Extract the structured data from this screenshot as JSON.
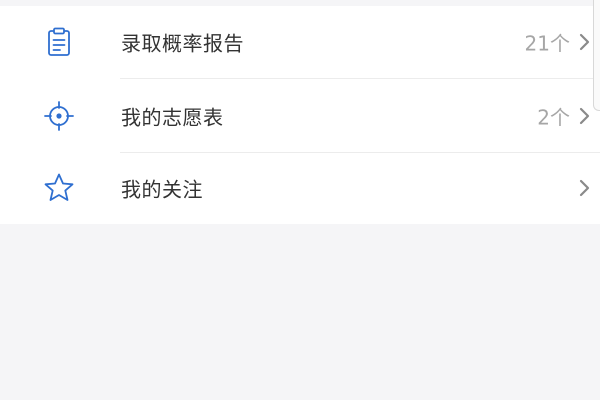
{
  "menu": {
    "items": [
      {
        "label": "录取概率报告",
        "count": "21个",
        "icon": "clipboard-report-icon"
      },
      {
        "label": "我的志愿表",
        "count": "2个",
        "icon": "target-crosshair-icon"
      },
      {
        "label": "我的关注",
        "count": "",
        "icon": "star-icon"
      }
    ]
  },
  "colors": {
    "icon_blue": "#2f6fd0",
    "label_text": "#333333",
    "count_text": "#a6a6a6",
    "chevron": "#8a8a8a",
    "background": "#f5f5f7",
    "card": "#ffffff"
  }
}
